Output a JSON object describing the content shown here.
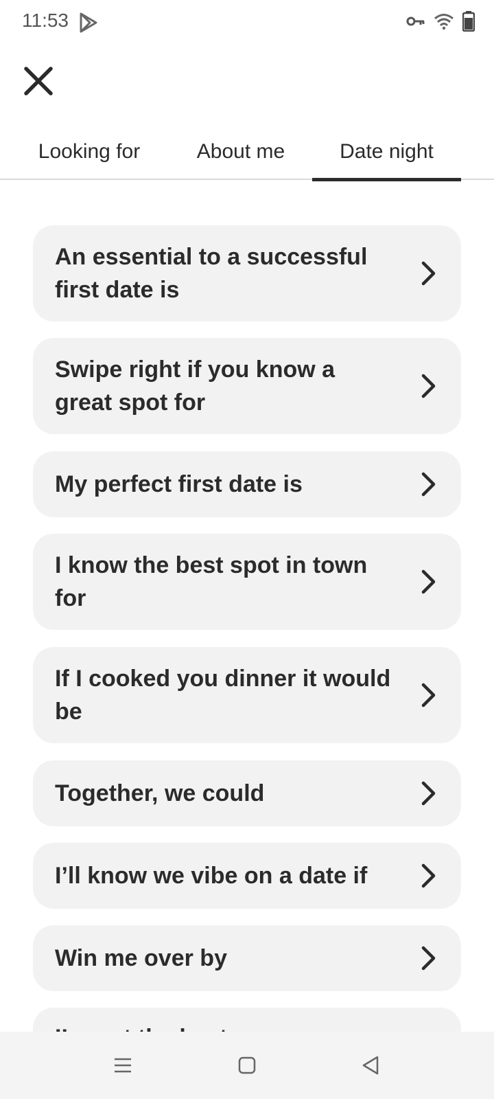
{
  "status_bar": {
    "time": "11:53",
    "icons": [
      "play-store-icon",
      "vpn-key-icon",
      "wifi-icon",
      "battery-icon"
    ]
  },
  "header": {
    "close_icon": "close-icon"
  },
  "tabs": [
    {
      "label": "Looking for",
      "selected": false
    },
    {
      "label": "About me",
      "selected": false
    },
    {
      "label": "Date night",
      "selected": true
    }
  ],
  "prompts": [
    {
      "text": "An essential to a successful first date is"
    },
    {
      "text": "Swipe right if you know a great spot for"
    },
    {
      "text": "My perfect first date is"
    },
    {
      "text": "I know the best spot in town for"
    },
    {
      "text": "If I cooked you dinner it would be"
    },
    {
      "text": "Together, we could"
    },
    {
      "text": "I’ll know we vibe on a date if"
    },
    {
      "text": "Win me over by"
    },
    {
      "text": "I’m not the best..."
    }
  ],
  "nav_bar": {
    "icons": [
      "menu-icon",
      "home-icon",
      "back-icon"
    ]
  },
  "colors": {
    "card_bg": "#f2f2f2",
    "text": "#2b2b2b",
    "tab_indicator": "#2b2b2b"
  }
}
